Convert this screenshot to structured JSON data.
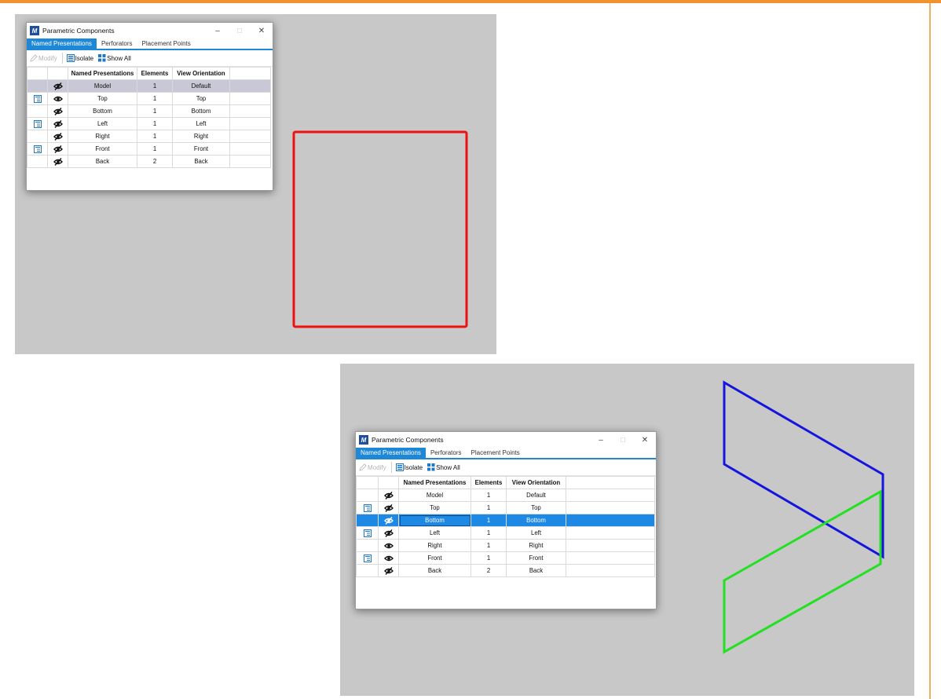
{
  "accent_color": "#f0922e",
  "window": {
    "title": "Parametric Components",
    "logo_icon": "app-logo-icon",
    "minimize_glyph": "–",
    "maximize_glyph": "□",
    "close_glyph": "✕"
  },
  "tabs": [
    "Named Presentations",
    "Perforators",
    "Placement Points"
  ],
  "toolbar": {
    "modify": "Modify",
    "isolate": "Isolate",
    "show_all": "Show All"
  },
  "columns": [
    "Named Presentations",
    "Elements",
    "View Orientation"
  ],
  "top_dialog": {
    "selected_row": "Model",
    "rows": [
      {
        "flag": false,
        "visible": false,
        "name": "Model",
        "elements": "1",
        "orientation": "Default"
      },
      {
        "flag": true,
        "visible": true,
        "name": "Top",
        "elements": "1",
        "orientation": "Top"
      },
      {
        "flag": false,
        "visible": false,
        "name": "Bottom",
        "elements": "1",
        "orientation": "Bottom"
      },
      {
        "flag": true,
        "visible": false,
        "name": "Left",
        "elements": "1",
        "orientation": "Left"
      },
      {
        "flag": false,
        "visible": false,
        "name": "Right",
        "elements": "1",
        "orientation": "Right"
      },
      {
        "flag": true,
        "visible": false,
        "name": "Front",
        "elements": "1",
        "orientation": "Front"
      },
      {
        "flag": false,
        "visible": false,
        "name": "Back",
        "elements": "2",
        "orientation": "Back"
      }
    ]
  },
  "bottom_dialog": {
    "selected_row": "Bottom",
    "rows": [
      {
        "flag": false,
        "visible": false,
        "name": "Model",
        "elements": "1",
        "orientation": "Default"
      },
      {
        "flag": true,
        "visible": false,
        "name": "Top",
        "elements": "1",
        "orientation": "Top"
      },
      {
        "flag": false,
        "visible": false,
        "name": "Bottom",
        "elements": "1",
        "orientation": "Bottom"
      },
      {
        "flag": true,
        "visible": false,
        "name": "Left",
        "elements": "1",
        "orientation": "Left"
      },
      {
        "flag": false,
        "visible": true,
        "name": "Right",
        "elements": "1",
        "orientation": "Right"
      },
      {
        "flag": true,
        "visible": true,
        "name": "Front",
        "elements": "1",
        "orientation": "Front"
      },
      {
        "flag": false,
        "visible": false,
        "name": "Back",
        "elements": "2",
        "orientation": "Back"
      }
    ]
  },
  "viewport": {
    "background": "#c8c8c8",
    "shape_colors": {
      "red": "#ee1111",
      "blue": "#1515dd",
      "green": "#22e022"
    }
  }
}
